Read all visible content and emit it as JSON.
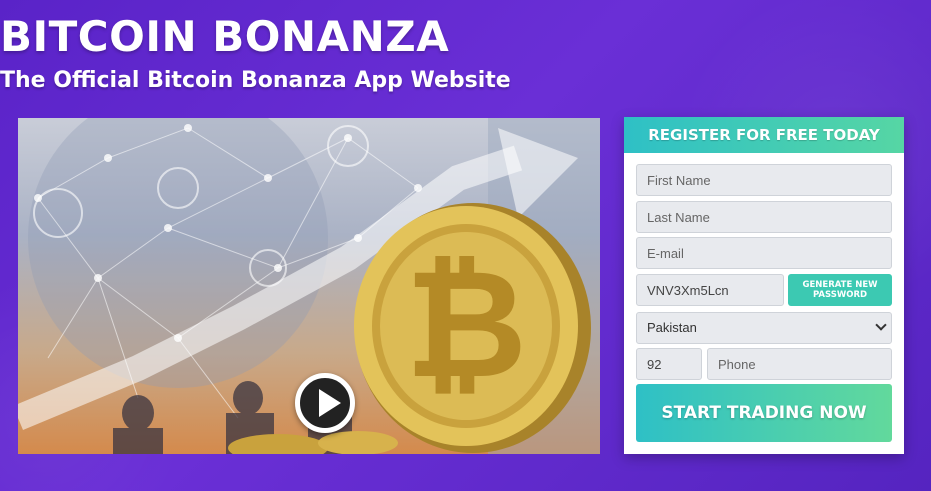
{
  "header": {
    "title": "BITCOIN BONANZA",
    "subtitle": "The Official Bitcoin Bonanza App Website"
  },
  "video": {
    "play_icon": "play-icon"
  },
  "form": {
    "heading": "REGISTER FOR FREE TODAY",
    "first_name_placeholder": "First Name",
    "last_name_placeholder": "Last Name",
    "email_placeholder": "E-mail",
    "password_value": "VNV3Xm5Lcn",
    "generate_label": "GENERATE NEW PASSWORD",
    "country_selected": "Pakistan",
    "phone_code_value": "92",
    "phone_placeholder": "Phone",
    "submit_label": "START TRADING NOW"
  },
  "colors": {
    "background": "#5a23c8",
    "accent_teal": "#2ec0c6",
    "accent_green": "#56d6a4"
  }
}
